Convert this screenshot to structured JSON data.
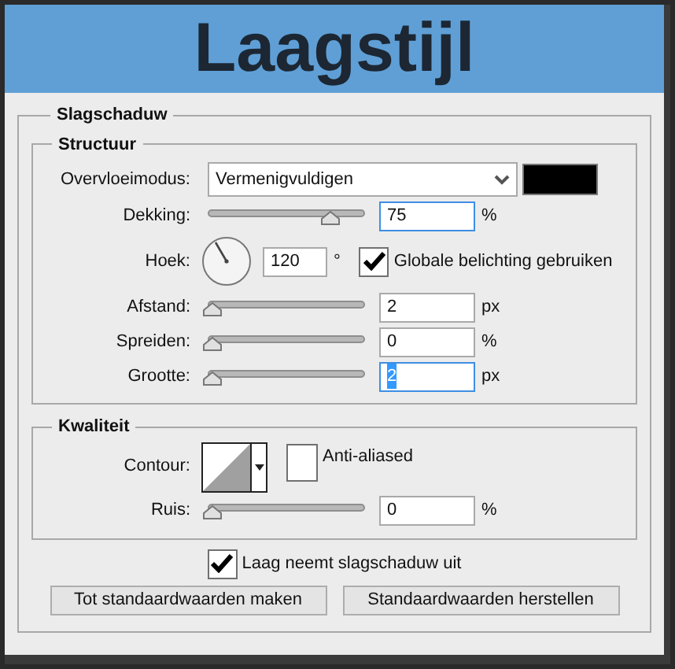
{
  "window": {
    "title": "Laagstijl"
  },
  "section": {
    "title": "Slagschaduw"
  },
  "structure": {
    "title": "Structuur",
    "blend_mode": {
      "label": "Overvloeimodus:",
      "value": "Vermenigvuldigen",
      "color": "#000000"
    },
    "rows": [
      {
        "kind": "slider",
        "label": "Dekking:",
        "level": 0.75,
        "value": "75",
        "unit": "%",
        "focused": true,
        "text_selected": false
      },
      {
        "kind": "angle",
        "label": "Hoek:",
        "value": "120",
        "unit": "°",
        "checkbox": {
          "label": "Globale belichting gebruiken",
          "checked": true
        }
      },
      {
        "kind": "slider",
        "label": "Afstand:",
        "level": 0.0,
        "value": "2",
        "unit": "px",
        "focused": false,
        "text_selected": false
      },
      {
        "kind": "slider",
        "label": "Spreiden:",
        "level": 0.0,
        "value": "0",
        "unit": "%",
        "focused": false,
        "text_selected": false
      },
      {
        "kind": "slider",
        "label": "Grootte:",
        "level": 0.0,
        "value": "2",
        "unit": "px",
        "focused": true,
        "text_selected": true
      }
    ]
  },
  "quality": {
    "title": "Kwaliteit",
    "contour": {
      "label": "Contour:",
      "checkbox": {
        "label": "Anti-aliased",
        "checked": false
      }
    },
    "rows": [
      {
        "kind": "slider",
        "label": "Ruis:",
        "level": 0.0,
        "value": "0",
        "unit": "%",
        "focused": false,
        "text_selected": false
      }
    ]
  },
  "knockout": {
    "label": "Laag neemt slagschaduw uit",
    "checked": true
  },
  "buttons": [
    "Tot standaardwaarden maken",
    "Standaardwaarden herstellen"
  ]
}
